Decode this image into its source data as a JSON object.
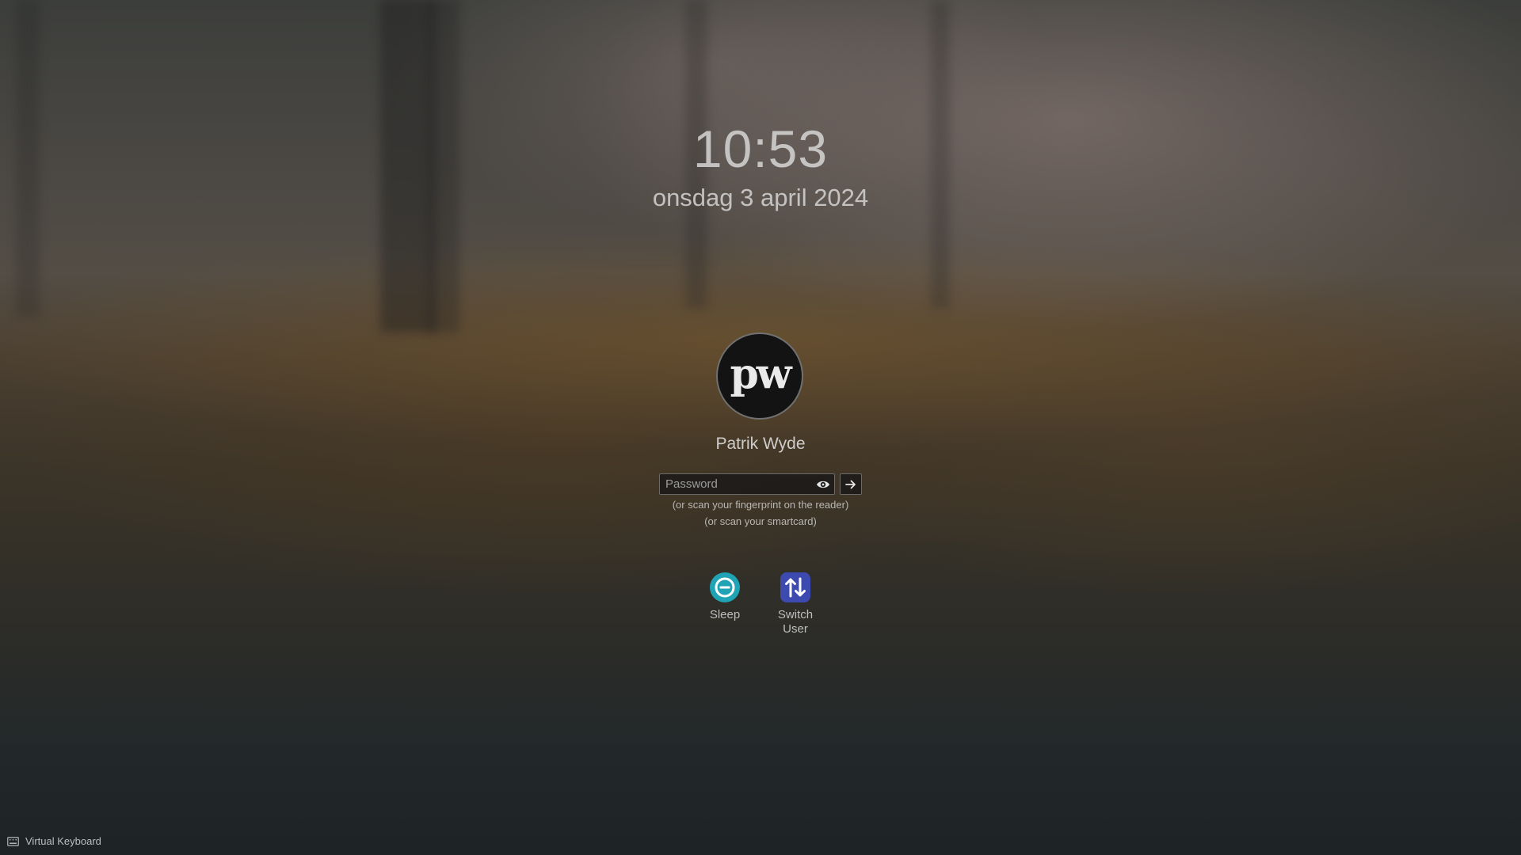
{
  "clock": {
    "time": "10:53",
    "date": "onsdag 3 april 2024"
  },
  "user": {
    "avatar_text": "pw",
    "name": "Patrik Wyde"
  },
  "login": {
    "password_placeholder": "Password",
    "password_value": "",
    "hint_fingerprint": "(or scan your fingerprint on the reader)",
    "hint_smartcard": "(or scan your smartcard)"
  },
  "actions": [
    {
      "label": "Sleep",
      "icon": "sleep-icon",
      "color": "#1fa3b5"
    },
    {
      "label": "Switch\nUser",
      "label_line1": "Switch",
      "label_line2": "User",
      "icon": "switch-user-icon",
      "color": "#3d4ab0"
    }
  ],
  "footer": {
    "virtual_keyboard_label": "Virtual Keyboard",
    "icon": "keyboard-icon"
  }
}
